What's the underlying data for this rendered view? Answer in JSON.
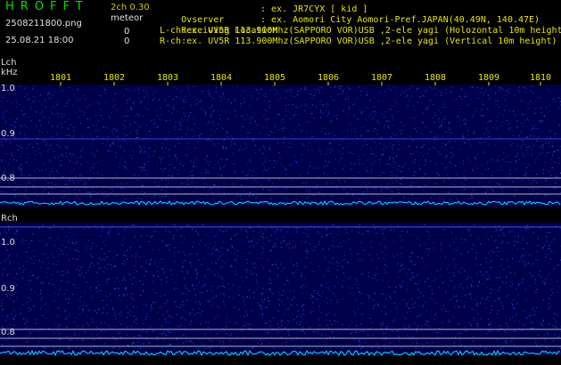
{
  "header": {
    "app_title": "HROFFT",
    "version": "2ch 0.30",
    "filename": "2508211800.png",
    "meteor_label": "meteor",
    "datetime": "25.08.21 18:00",
    "count_lch": "0",
    "count_rch": "0",
    "observer_label": "Ovserver",
    "observer_value": ": ex. JR7CYX [ kid ]",
    "location_label": "Receiving Location",
    "location_value": ": ex. Aomori City Aomori-Pref.JAPAN(40.49N, 140.47E)",
    "lch_info": "L-ch:ex. UV5R 113.900Mhz(SAPPORO VOR)USB ,2-ele yagi (Holozontal 10m height)",
    "rch_info": "R-ch:ex. UV5R 113.900Mhz(SAPPORO VOR)USB ,2-ele yagi (Vertical 10m height)"
  },
  "panels": {
    "lch_label": "Lch",
    "unit_label": "kHz",
    "rch_label": "Rch",
    "time_ticks": [
      "1801",
      "1802",
      "1803",
      "1804",
      "1805",
      "1806",
      "1807",
      "1808",
      "1809",
      "1810"
    ],
    "freq_ticks": [
      "1.0",
      "0.9",
      "0.8"
    ]
  },
  "colors": {
    "title": "#00e000",
    "info_text": "#e6e600",
    "tick_text": "#e6e600",
    "waterfall_dark": "#00006a",
    "waterfall_bright": "#4a4aff",
    "level_trace": "#00e5ff"
  }
}
